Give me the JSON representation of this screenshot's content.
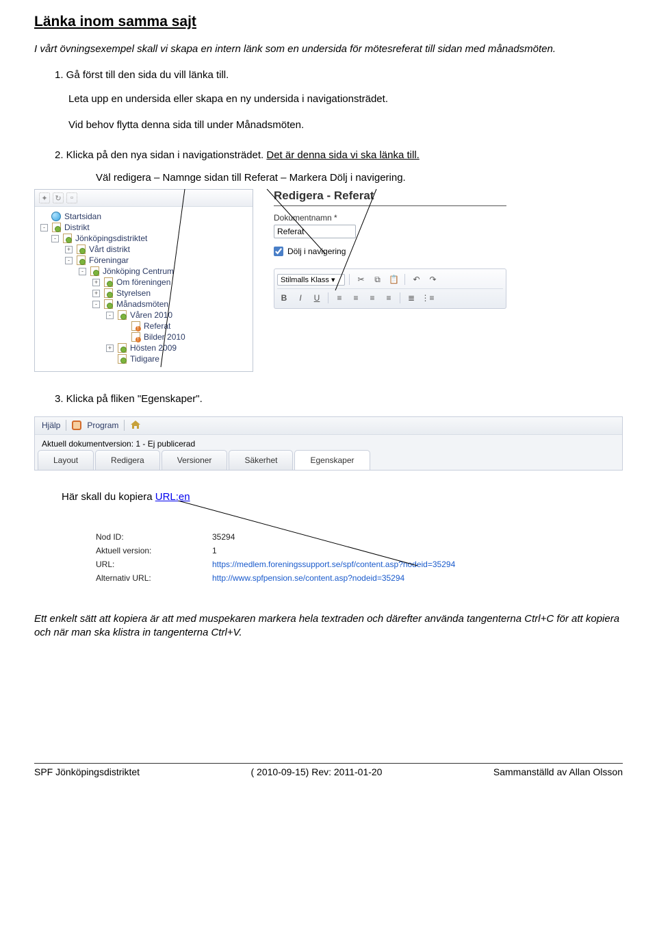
{
  "heading": "Länka inom samma sajt",
  "intro": "I vårt övningsexempel skall vi skapa en intern länk som en undersida för mötesreferat till sidan med månadsmöten.",
  "steps": {
    "s1": "1.  Gå först till den sida du vill länka till.",
    "s1b": "Leta upp en undersida eller skapa en ny undersida i navigationsträdet.",
    "s1c": "Vid behov flytta denna sida till under Månadsmöten.",
    "s2a": "2.  Klicka på den nya sidan i navigationsträdet. ",
    "s2b": "Det är denna sida vi ska länka till.",
    "s2c": "Väl redigera – Namnge sidan till Referat – Markera Dölj i navigering.",
    "s3": "3.  Klicka på fliken \"Egenskaper\".",
    "copy_label_a": "Här skall du kopiera ",
    "copy_label_b": "URL:en",
    "closing": "Ett enkelt sätt att kopiera är att med muspekaren markera hela textraden och därefter använda tangenterna Ctrl+C för att kopiera och när man ska klistra in tangenterna Ctrl+V."
  },
  "tree": {
    "items": [
      {
        "ind": 0,
        "tw": "",
        "icon": "globe",
        "label": "Startsidan"
      },
      {
        "ind": 0,
        "tw": "-",
        "icon": "page pub",
        "label": "Distrikt"
      },
      {
        "ind": 1,
        "tw": "-",
        "icon": "page pub",
        "label": "Jönköpingsdistriktet"
      },
      {
        "ind": 2,
        "tw": "+",
        "icon": "page pub",
        "label": "Vårt distrikt"
      },
      {
        "ind": 2,
        "tw": "-",
        "icon": "page pub",
        "label": "Föreningar"
      },
      {
        "ind": 3,
        "tw": "-",
        "icon": "page pub",
        "label": "Jönköping Centrum"
      },
      {
        "ind": 4,
        "tw": "+",
        "icon": "page pub",
        "label": "Om föreningen"
      },
      {
        "ind": 4,
        "tw": "+",
        "icon": "page pub",
        "label": "Styrelsen"
      },
      {
        "ind": 4,
        "tw": "-",
        "icon": "page pub",
        "label": "Månadsmöten"
      },
      {
        "ind": 5,
        "tw": "-",
        "icon": "page pub",
        "label": "Våren 2010"
      },
      {
        "ind": 6,
        "tw": "",
        "icon": "page unpub",
        "label": "Referat"
      },
      {
        "ind": 6,
        "tw": "",
        "icon": "page unpub",
        "label": "Bilder 2010"
      },
      {
        "ind": 5,
        "tw": "+",
        "icon": "page pub",
        "label": "Hösten 2009"
      },
      {
        "ind": 5,
        "tw": "",
        "icon": "page pub",
        "label": "Tidigare"
      }
    ]
  },
  "editor": {
    "title": "Redigera - Referat",
    "doc_label": "Dokumentnamn *",
    "doc_value": "Referat",
    "hide_label": "Dölj i navigering",
    "style_select": "Stilmalls Klass"
  },
  "topbar": {
    "help": "Hjälp",
    "program": "Program",
    "version_text": "Aktuell dokumentversion: 1 - Ej publicerad",
    "tabs": [
      "Layout",
      "Redigera",
      "Versioner",
      "Säkerhet",
      "Egenskaper"
    ]
  },
  "props": {
    "rows": [
      {
        "label": "Nod ID:",
        "value": "35294"
      },
      {
        "label": "Aktuell version:",
        "value": "1"
      },
      {
        "label": "URL:",
        "value": "https://medlem.foreningssupport.se/spf/content.asp?nodeid=35294",
        "link": true
      },
      {
        "label": "Alternativ URL:",
        "value": "http://www.spfpension.se/content.asp?nodeid=35294",
        "link": true
      }
    ]
  },
  "footer": {
    "left": "SPF Jönköpingsdistriktet",
    "center": "( 2010-09-15) Rev: 2011-01-20",
    "right": "Sammanställd av Allan Olsson"
  }
}
